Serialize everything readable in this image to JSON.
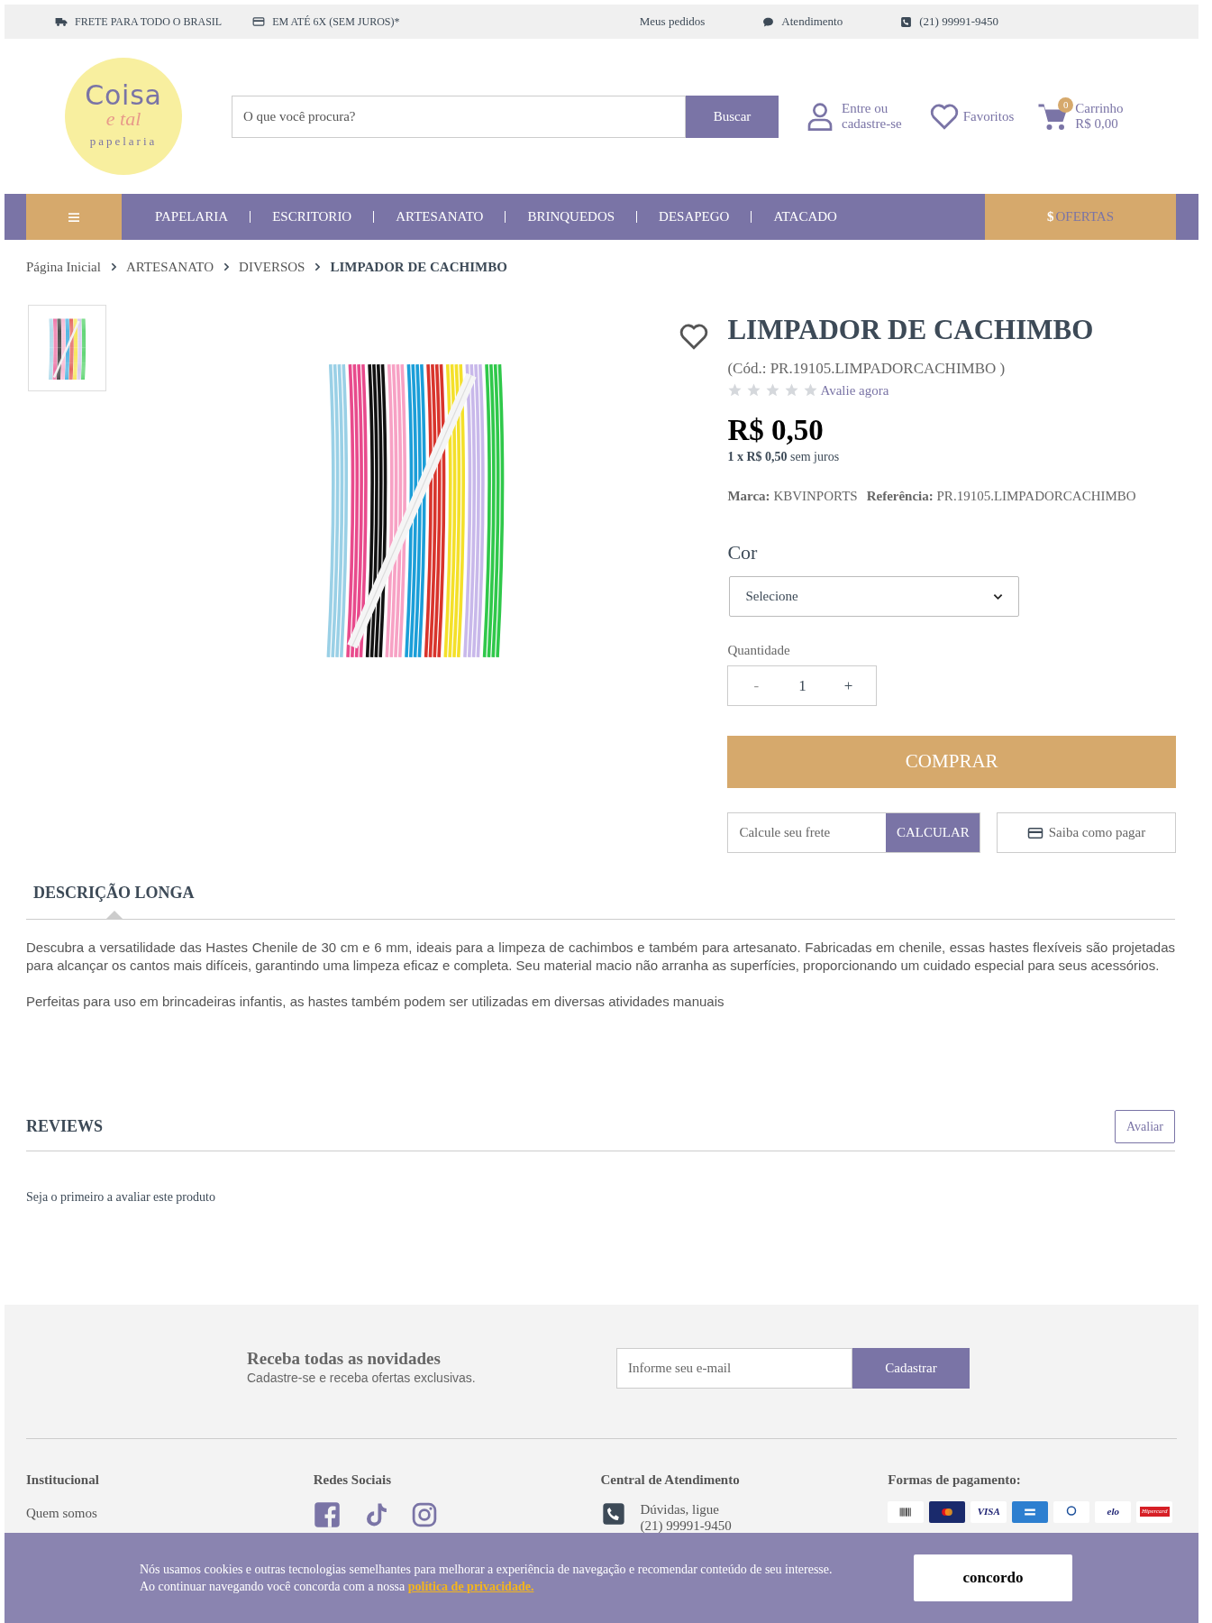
{
  "top_bar": {
    "left": [
      "FRETE PARA TODO O BRASIL",
      "EM ATÉ 6X (SEM JUROS)*"
    ],
    "right": [
      "Meus pedidos",
      "Atendimento",
      "(21) 99991-9450"
    ]
  },
  "logo": {
    "line_1": "Coisa",
    "line_2": "e tal",
    "line_3": "papelaria"
  },
  "search": {
    "placeholder": "O que você procura?",
    "button": "Buscar"
  },
  "account": {
    "line_1": "Entre ou",
    "line_2": "cadastre-se"
  },
  "favorites": {
    "label": "Favoritos"
  },
  "cart": {
    "count": "0",
    "label": "Carrinho",
    "total": "R$ 0,00"
  },
  "nav": {
    "items": [
      "PAPELARIA",
      "ESCRITORIO",
      "ARTESANATO",
      "BRINQUEDOS",
      "DESAPEGO",
      "ATACADO"
    ],
    "offers": {
      "symbol": "$",
      "label": "OFERTAS"
    }
  },
  "breadcrumb": [
    {
      "label": "Página Inicial",
      "current": false
    },
    {
      "label": "ARTESANATO",
      "current": false
    },
    {
      "label": "DIVERSOS",
      "current": false
    },
    {
      "label": "LIMPADOR DE CACHIMBO",
      "current": true
    }
  ],
  "product": {
    "title": "LIMPADOR DE CACHIMBO",
    "code": "(Cód.: PR.19105.LIMPADORCACHIMBO )",
    "stars": 0,
    "rate_link": "Avalie agora",
    "price": "R$ 0,50",
    "installments": "**1 x R$ 0,50** sem juros",
    "brand": "**Marca:** KBVINPORTS",
    "reference": "**Referência:** PR.19105.LIMPADORCACHIMBO",
    "option_label": "Cor",
    "option_value": "Selecione",
    "quantity_label": "Quantidade",
    "quantity_minus": "-",
    "quantity": "1",
    "quantity_plus": "+",
    "buy_button": "COMPRAR",
    "shipping_placeholder": "Calcule seu frete",
    "shipping_button": "CALCULAR",
    "payment_info": "Saiba como pagar"
  },
  "description": {
    "tab": "DESCRIÇÃO LONGA",
    "paragraphs": [
      "Descubra a versatilidade das Hastes Chenile de 30 cm e 6 mm, ideais para a limpeza de cachimbos e também para artesanato. Fabricadas em chenile, essas hastes flexíveis são projetadas para alcançar os cantos mais difíceis, garantindo uma limpeza eficaz e completa. Seu material macio não arranha as superfícies, proporcionando um cuidado especial para seus acessórios.",
      "Perfeitas para uso em brincadeiras infantis, as hastes também podem ser utilizadas em diversas atividades manuais"
    ]
  },
  "reviews": {
    "title": "REVIEWS",
    "button": "Avaliar",
    "empty": "Seja o primeiro a avaliar este produto"
  },
  "newsletter": {
    "title": "Receba todas as novidades",
    "subtitle": "Cadastre-se e receba ofertas exclusivas.",
    "placeholder": "Informe seu e-mail",
    "button": "Cadastrar"
  },
  "footer": {
    "institutional": {
      "title": "Institucional",
      "links": [
        "Quem somos"
      ]
    },
    "social": {
      "title": "Redes Sociais"
    },
    "support": {
      "title": "Central de Atendimento",
      "items": [
        {
          "line_1": "Dúvidas, ligue",
          "line_2": "(21) 99991-9450"
        }
      ]
    },
    "payment": {
      "title": "Formas de pagamento:",
      "methods": [
        {
          "kind": "boleto"
        },
        {
          "kind": "mastercard"
        },
        {
          "kind": "plain",
          "label": "VISA"
        },
        {
          "kind": "amex"
        },
        {
          "kind": "diners"
        },
        {
          "kind": "plain",
          "label": "elo"
        },
        {
          "kind": "hipercard",
          "label": "Hipercard"
        }
      ]
    }
  },
  "cookie_banner": {
    "text": "Nós usamos cookies e outras tecnologias semelhantes para melhorar a experiência de navegação e recomendar conteúdo de seu interesse. Ao continuar navegando você concorda com a nossa ",
    "link": "política de privacidade.",
    "button": "concordo"
  }
}
